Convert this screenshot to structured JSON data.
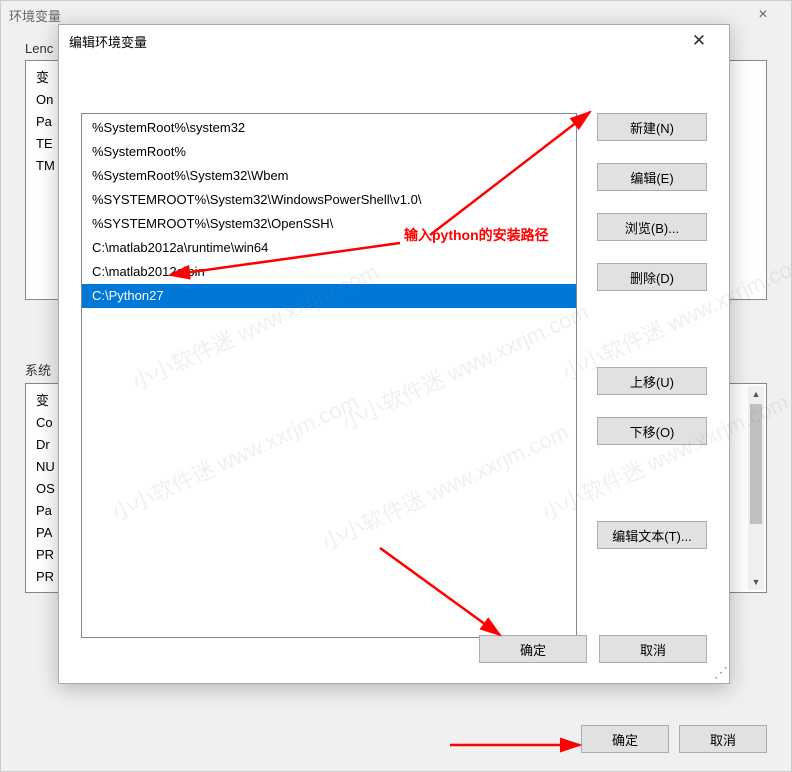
{
  "parent": {
    "title": "环境变量",
    "user_section_label": "Lenc",
    "user_vars": [
      "变",
      "On",
      "Pa",
      "TE",
      "TM"
    ],
    "system_section_label": "系统",
    "system_vars": [
      "变",
      "Co",
      "Dr",
      "NU",
      "OS",
      "Pa",
      "PA",
      "PR",
      "PR"
    ],
    "ok_label": "确定",
    "cancel_label": "取消"
  },
  "child": {
    "title": "编辑环境变量",
    "paths": [
      "%SystemRoot%\\system32",
      "%SystemRoot%",
      "%SystemRoot%\\System32\\Wbem",
      "%SYSTEMROOT%\\System32\\WindowsPowerShell\\v1.0\\",
      "%SYSTEMROOT%\\System32\\OpenSSH\\",
      "C:\\matlab2012a\\runtime\\win64",
      "C:\\matlab2012a\\bin",
      "C:\\Python27"
    ],
    "selected_index": 7,
    "buttons": {
      "new": "新建(N)",
      "edit": "编辑(E)",
      "browse": "浏览(B)...",
      "delete": "删除(D)",
      "moveup": "上移(U)",
      "movedown": "下移(O)",
      "edittext": "编辑文本(T)..."
    },
    "ok_label": "确定",
    "cancel_label": "取消"
  },
  "annotation": {
    "text": "输入python的安装路径"
  },
  "watermark": "小小软件迷 www.xxrjm.com"
}
